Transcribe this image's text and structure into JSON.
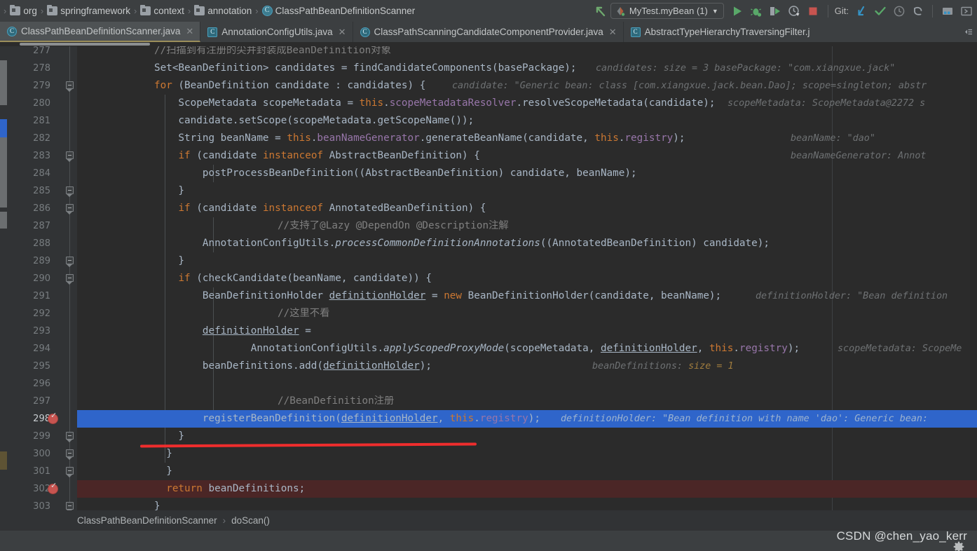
{
  "window": {
    "breadcrumb": [
      {
        "icon": "folder-icon",
        "label": "org"
      },
      {
        "icon": "folder-icon",
        "label": "springframework"
      },
      {
        "icon": "folder-icon",
        "label": "context"
      },
      {
        "icon": "folder-icon",
        "label": "annotation"
      },
      {
        "icon": "java-class-icon",
        "label": "ClassPathBeanDefinitionScanner"
      }
    ],
    "separator": "›"
  },
  "toolbar": {
    "back_icon": "arrow-up-left-icon",
    "run_configuration": "MyTest.myBean (1)",
    "run_config_dropdown_icon": "chevron-down-icon",
    "run_icon": "run-play-icon",
    "debug_icon": "debug-bug-icon",
    "run_coverage_icon": "run-with-coverage-icon",
    "profile_icon": "profiler-icon",
    "stop_icon": "stop-square-icon",
    "git_label": "Git:",
    "git_update_icon": "update-project-arrow-icon",
    "git_commit_icon": "commit-check-icon",
    "git_history_icon": "history-clock-icon",
    "git_revert_icon": "revert-undo-icon",
    "search_everywhere_icon": "project-structure-icon",
    "more_icon": "more-tools-icon",
    "colors": {
      "run_green": "#59a869",
      "stop_red": "#c75450",
      "accent_blue": "#3592c4",
      "tab_underline": "#9b8e5a"
    }
  },
  "tabs": [
    {
      "label": "ClassPathBeanDefinitionScanner.java",
      "icon": "java-class-icon",
      "active": true,
      "closable": true
    },
    {
      "label": "AnnotationConfigUtils.java",
      "icon": "java-class-icon",
      "active": false,
      "closable": true
    },
    {
      "label": "ClassPathScanningCandidateComponentProvider.java",
      "icon": "java-class-icon",
      "active": false,
      "closable": true
    },
    {
      "label": "AbstractTypeHierarchyTraversingFilter.j",
      "icon": "java-class-icon",
      "active": false,
      "closable": false
    }
  ],
  "tab_overflow_icon": "tab-list-icon",
  "editor": {
    "first_visible_line": 277,
    "current_line": 298,
    "breakpoint_lines": [
      298,
      302
    ],
    "lines": [
      {
        "no": 277,
        "clipped": true
      },
      {
        "no": 278
      },
      {
        "no": 279,
        "fold": true
      },
      {
        "no": 280
      },
      {
        "no": 281
      },
      {
        "no": 282
      },
      {
        "no": 283,
        "fold": true
      },
      {
        "no": 284
      },
      {
        "no": 285,
        "fold": true
      },
      {
        "no": 286,
        "fold": true
      },
      {
        "no": 287
      },
      {
        "no": 288
      },
      {
        "no": 289,
        "fold": true
      },
      {
        "no": 290,
        "fold": true
      },
      {
        "no": 291
      },
      {
        "no": 292
      },
      {
        "no": 293
      },
      {
        "no": 294
      },
      {
        "no": 295
      },
      {
        "no": 296
      },
      {
        "no": 297
      },
      {
        "no": 298,
        "selected": true,
        "breakpoint": true
      },
      {
        "no": 299,
        "fold": true
      },
      {
        "no": 300,
        "fold": true
      },
      {
        "no": 301,
        "fold": true
      },
      {
        "no": 302,
        "breakpoint": true,
        "bphighlight": true
      },
      {
        "no": 303,
        "fold": true
      }
    ],
    "code_text": {
      "l277": "//扫描到有注册的尖并封装成BeanDefinition对象",
      "l278": "Set<BeanDefinition> candidates = findCandidateComponents(basePackage);",
      "l279": "for (BeanDefinition candidate : candidates) {",
      "l280": "ScopeMetadata scopeMetadata = this.scopeMetadataResolver.resolveScopeMetadata(candidate);",
      "l281": "candidate.setScope(scopeMetadata.getScopeName());",
      "l282": "String beanName = this.beanNameGenerator.generateBeanName(candidate, this.registry);",
      "l283": "if (candidate instanceof AbstractBeanDefinition) {",
      "l284": "postProcessBeanDefinition((AbstractBeanDefinition) candidate, beanName);",
      "l285": "}",
      "l286": "if (candidate instanceof AnnotatedBeanDefinition) {",
      "l287": "//支持了@Lazy @DependOn @Description注解",
      "l288": "AnnotationConfigUtils.processCommonDefinitionAnnotations((AnnotatedBeanDefinition) candidate);",
      "l289": "}",
      "l290": "if (checkCandidate(beanName, candidate)) {",
      "l291": "BeanDefinitionHolder definitionHolder = new BeanDefinitionHolder(candidate, beanName);",
      "l292": "//这里不看",
      "l293": "definitionHolder =",
      "l294": "AnnotationConfigUtils.applyScopedProxyMode(scopeMetadata, definitionHolder, this.registry);",
      "l295": "beanDefinitions.add(definitionHolder);",
      "l296": "",
      "l297": "//BeanDefinition注册",
      "l298": "registerBeanDefinition(definitionHolder, this.registry);",
      "l299": "}",
      "l300": "}",
      "l301": "}",
      "l302": "return beanDefinitions;",
      "l303": "}"
    },
    "inline_hints": {
      "l278": "candidates:  size = 3   basePackage: \"com.xiangxue.jack\"",
      "l279": "candidate: \"Generic bean: class [com.xiangxue.jack.bean.Dao]; scope=singleton; abstr",
      "l280": "scopeMetadata: ScopeMetadata@2272  s",
      "l282": "beanName: \"dao\"   beanNameGenerator: Annot",
      "l291": "definitionHolder: \"Bean definition",
      "l294": "scopeMetadata: ScopeMe",
      "l295": "beanDefinitions:  size = 1",
      "l298": "definitionHolder: \"Bean definition with name 'dao': Generic bean:"
    }
  },
  "editor_breadcrumb": {
    "class": "ClassPathBeanDefinitionScanner",
    "separator": "›",
    "method": "doScan()"
  },
  "watermark": {
    "text": "CSDN @chen_yao_kerr"
  },
  "status_bar": {
    "settings_icon": "gear-icon"
  },
  "annotation": {
    "red_underline": true
  }
}
